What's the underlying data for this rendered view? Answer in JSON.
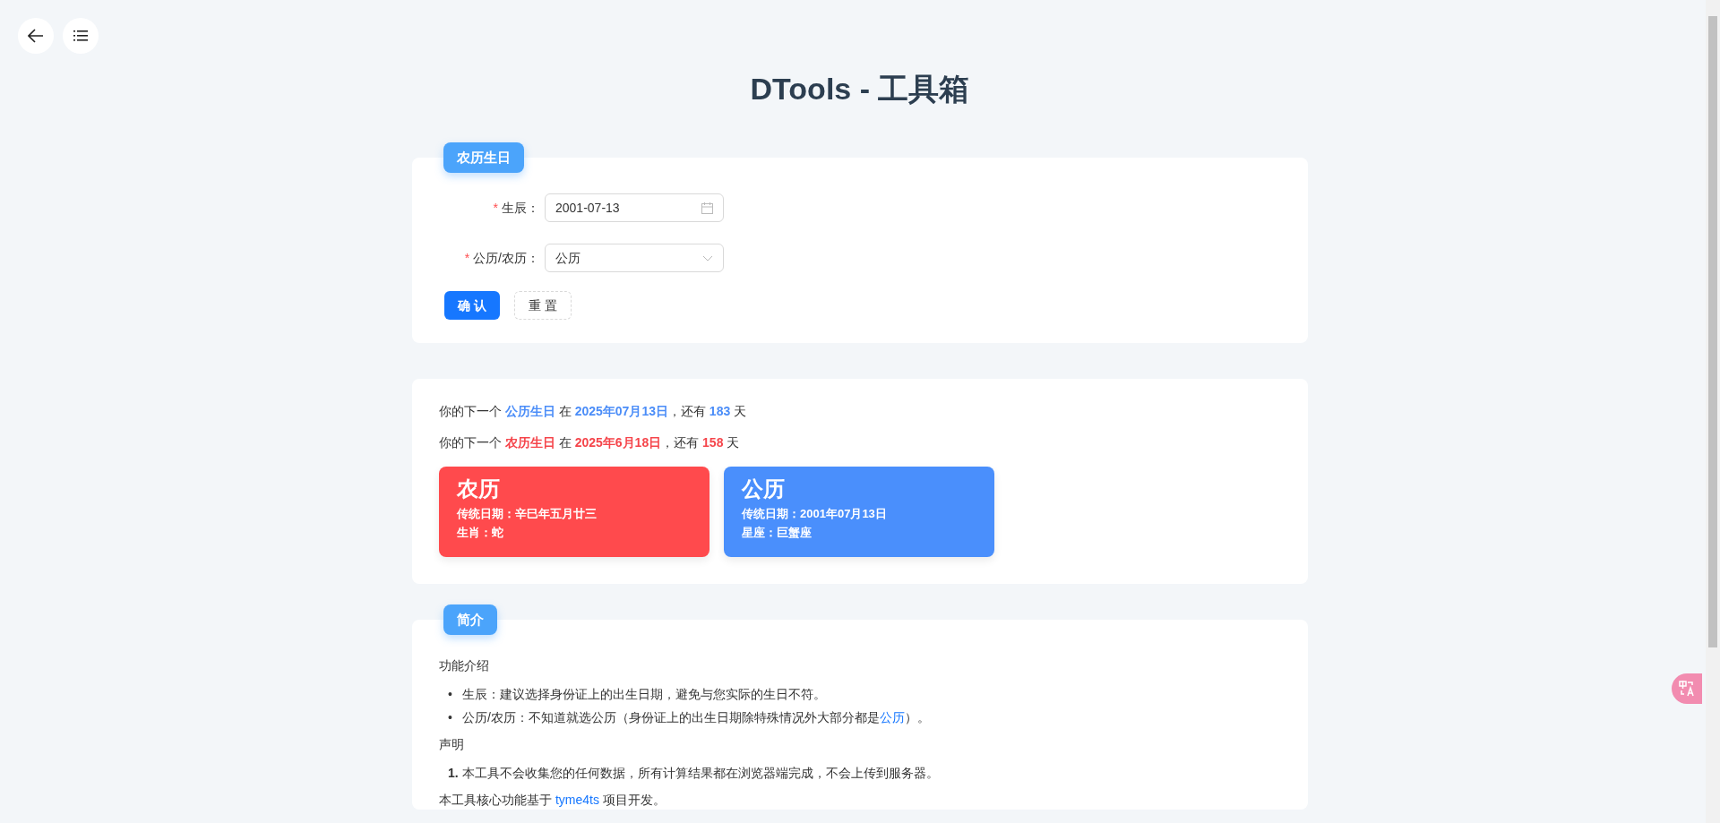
{
  "title": "DTools - 工具箱",
  "form": {
    "badge": "农历生日",
    "fields": [
      {
        "kind": "date",
        "label": "生辰：",
        "required_mark": "*",
        "value": "2001-07-13"
      },
      {
        "kind": "select",
        "label": "公历/农历：",
        "required_mark": "*",
        "value": "公历"
      }
    ],
    "buttons": [
      {
        "kind": "primary",
        "label": "确 认"
      },
      {
        "kind": "dashed",
        "label": "重 置"
      }
    ]
  },
  "result": {
    "lines": [
      {
        "color": "#4b8df8",
        "parts": [
          "你的下一个 ",
          "公历生日",
          " 在 ",
          "2025年07月13日",
          "，还有 ",
          "183",
          " 天"
        ]
      },
      {
        "color": "#f5454b",
        "parts": [
          "你的下一个 ",
          "农历生日",
          " 在 ",
          "2025年6月18日",
          "，还有 ",
          "158",
          " 天"
        ]
      }
    ],
    "cards": [
      {
        "color": "#ff4a4d",
        "title": "农历",
        "lines": [
          "传统日期：辛巳年五月廿三",
          "生肖：蛇"
        ]
      },
      {
        "color": "#4a8ffc",
        "title": "公历",
        "lines": [
          "传统日期：2001年07月13日",
          "星座：巨蟹座"
        ]
      }
    ]
  },
  "intro": {
    "badge": "简介",
    "blocks": [
      {
        "kind": "heading",
        "text": "功能介绍"
      },
      {
        "kind": "bullets",
        "markers": [
          "•",
          "•"
        ],
        "items": [
          [
            "生辰：建议选择身份证上的出生日期，避免与您实际的生日不符。"
          ],
          [
            "公历/农历：不知道就选公历（身份证上的出生日期除特殊情况外大部分都是",
            "公历",
            "）。"
          ]
        ]
      },
      {
        "kind": "heading",
        "text": "声明"
      },
      {
        "kind": "numbered",
        "markers": [
          "1."
        ],
        "items": [
          [
            "本工具不会收集您的任何数据，所有计算结果都在浏览器端完成，不会上传到服务器。"
          ]
        ]
      },
      {
        "kind": "para",
        "parts": [
          "本工具核心功能基于 ",
          "tyme4ts",
          " 项目开发。"
        ]
      }
    ]
  }
}
